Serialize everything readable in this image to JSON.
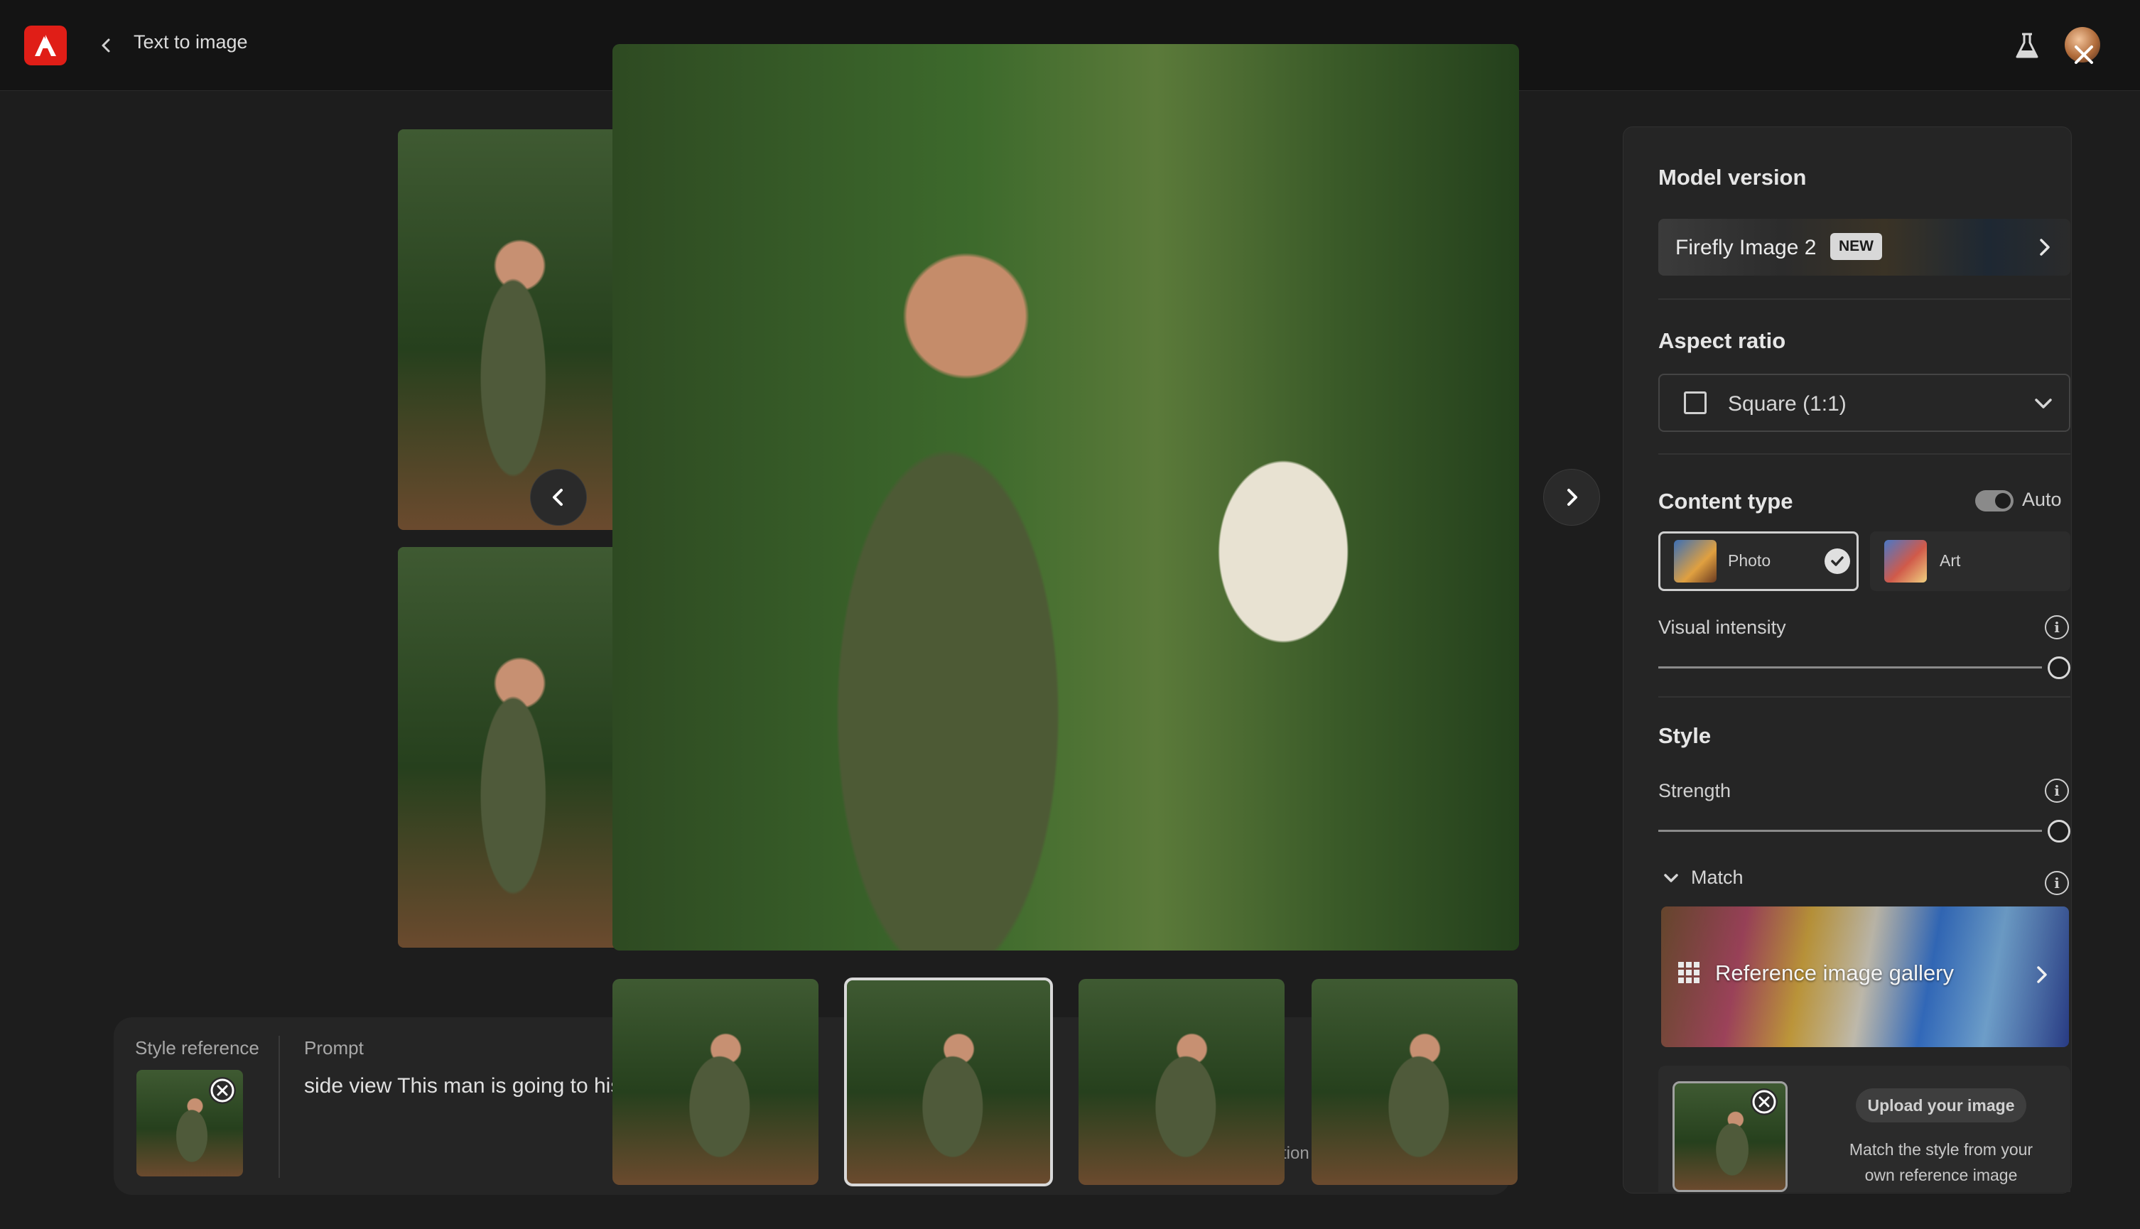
{
  "header": {
    "title": "Text to image",
    "icons": {
      "logo": "adobe-logo",
      "back": "chevron-left-icon",
      "labs": "flask-icon",
      "close": "close-icon"
    }
  },
  "viewer": {
    "prev_icon": "chevron-left-icon",
    "next_icon": "chevron-right-icon",
    "filmstrip": [
      {
        "alt": "image-1",
        "selected": false
      },
      {
        "alt": "image-2",
        "selected": true
      },
      {
        "alt": "image-3",
        "selected": false
      },
      {
        "alt": "image-4",
        "selected": false
      }
    ]
  },
  "prompt_bar": {
    "style_reference_label": "Style reference",
    "prompt_label": "Prompt",
    "prompt_text": "side view This man is going to his",
    "truncated_tail": "tion"
  },
  "settings": {
    "model_version": {
      "heading": "Model version",
      "value": "Firefly Image 2",
      "badge": "NEW"
    },
    "aspect_ratio": {
      "heading": "Aspect ratio",
      "value": "Square (1:1)"
    },
    "content_type": {
      "heading": "Content type",
      "auto_label": "Auto",
      "auto_on": true,
      "options": [
        {
          "label": "Photo",
          "selected": true
        },
        {
          "label": "Art",
          "selected": false
        }
      ]
    },
    "visual_intensity": {
      "label": "Visual intensity",
      "value": 1.0
    },
    "style": {
      "heading": "Style",
      "strength_label": "Strength",
      "strength_value": 1.0,
      "match_label": "Match",
      "gallery_label": "Reference image gallery",
      "upload_button": "Upload your image",
      "upload_desc": "Match the style from your own reference image"
    }
  },
  "colors": {
    "accent_logo": "#e01e17",
    "panel": "#252525",
    "background": "#1d1d1d"
  }
}
